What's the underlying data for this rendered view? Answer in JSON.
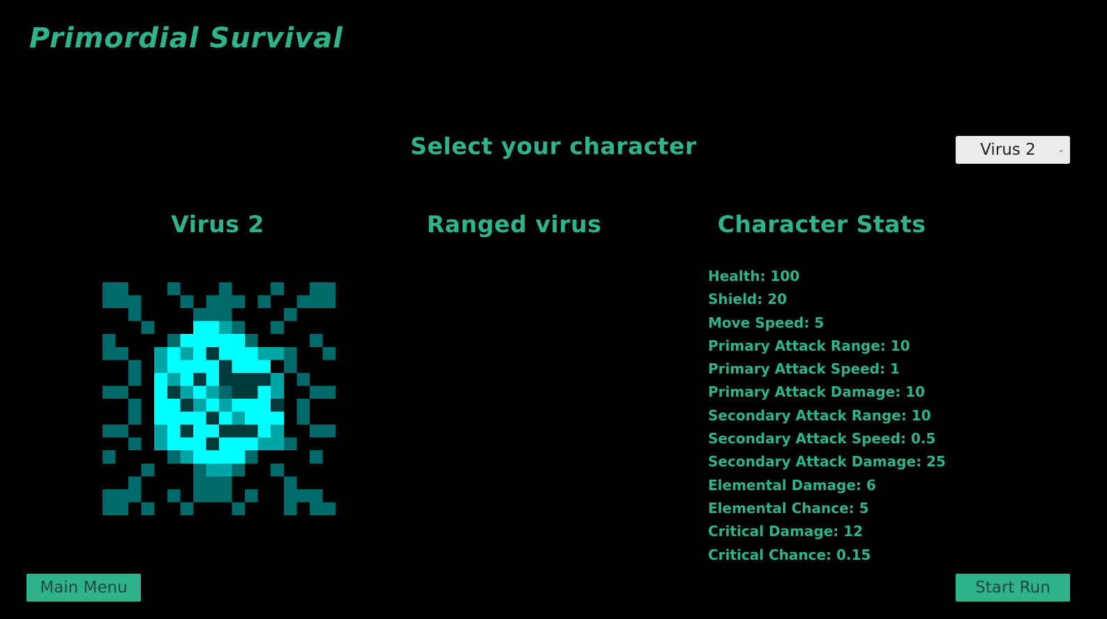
{
  "header": {
    "game_title": "Primordial Survival"
  },
  "character_select": {
    "heading": "Select your character",
    "dropdown": {
      "selected": "Virus 2",
      "options": [
        "Virus 2"
      ]
    }
  },
  "character": {
    "name": "Virus 2",
    "type": "Ranged virus",
    "sprite": "virus-sprite"
  },
  "stats": {
    "heading": "Character Stats",
    "items": [
      "Health: 100",
      "Shield: 20",
      "Move Speed: 5",
      "Primary Attack Range: 10",
      "Primary Attack Speed: 1",
      "Primary Attack Damage: 10",
      "Secondary Attack Range: 10",
      "Secondary Attack Speed: 0.5",
      "Secondary Attack Damage: 25",
      "Elemental Damage: 6",
      "Elemental Chance: 5",
      "Critical Damage: 12",
      "Critical Chance: 0.15"
    ]
  },
  "buttons": {
    "main_menu": "Main Menu",
    "start_run": "Start Run"
  },
  "colors": {
    "background": "#000000",
    "accent": "#2fb38c",
    "button_text": "#1f4a3d",
    "dropdown_bg": "#ececec",
    "sprite_dark": "#006a6a",
    "sprite_mid": "#00a6a6",
    "sprite_bright": "#00ffff",
    "sprite_shadow": "#003a3a"
  }
}
